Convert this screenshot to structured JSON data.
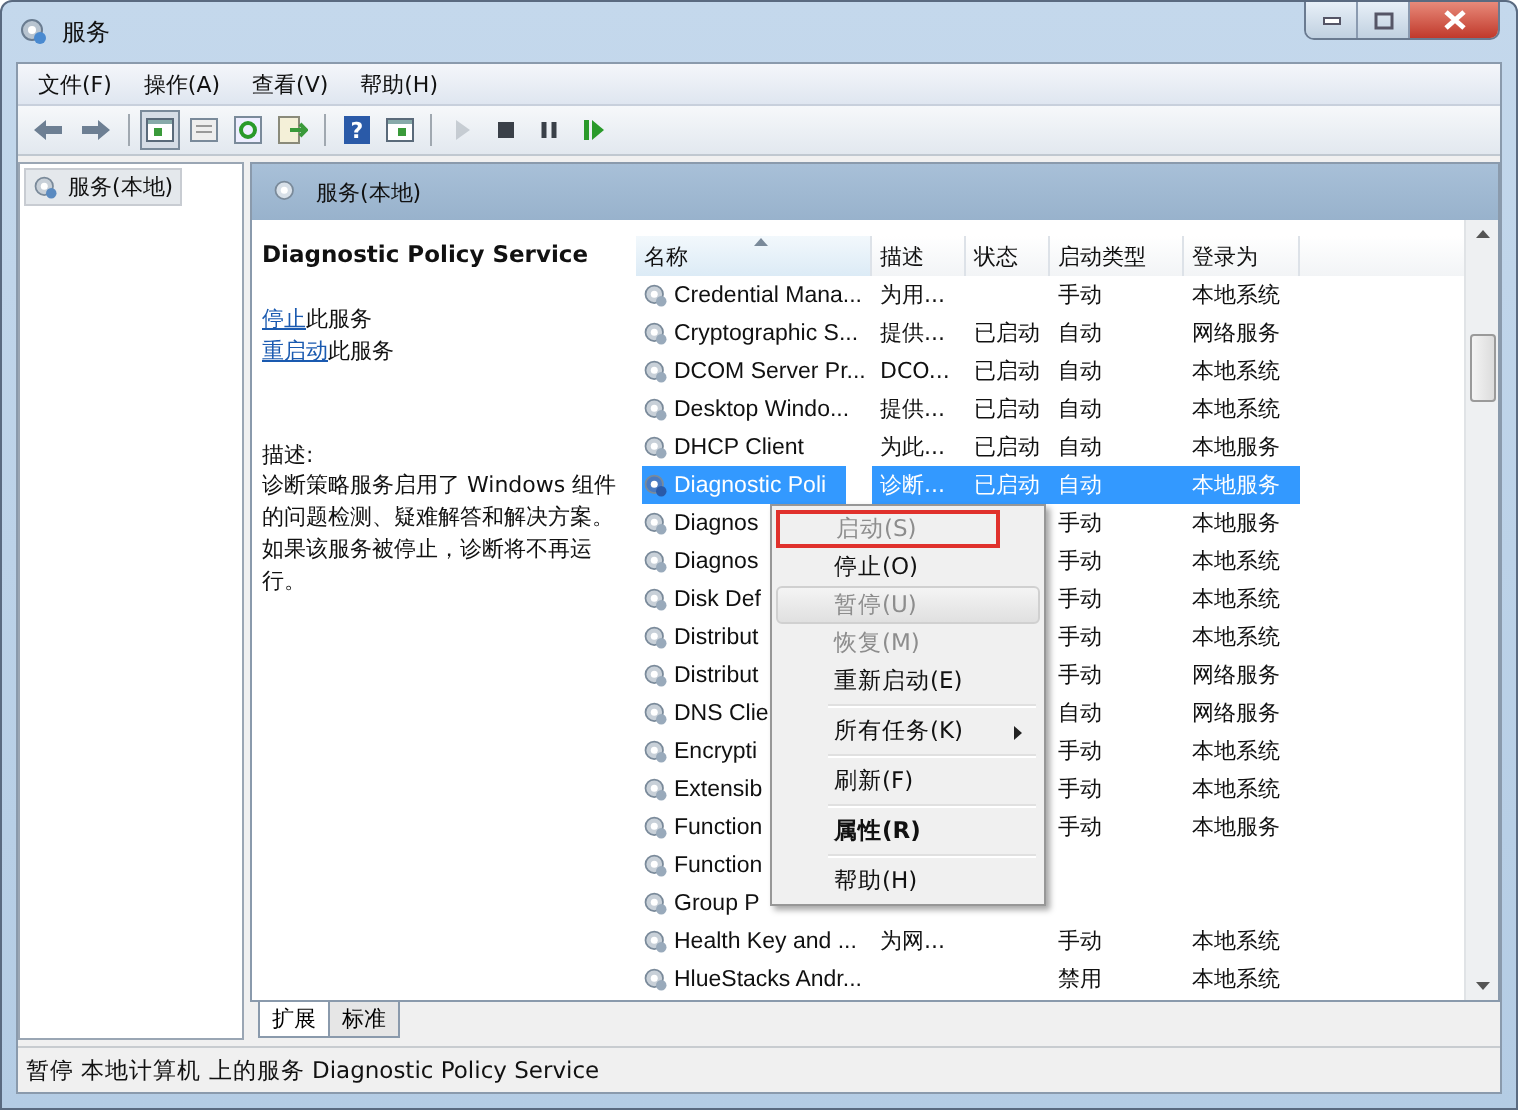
{
  "window": {
    "title": "服务"
  },
  "menu": [
    "文件(F)",
    "操作(A)",
    "查看(V)",
    "帮助(H)"
  ],
  "toolbar": [
    {
      "kind": "back",
      "pressed": false,
      "disabled": false
    },
    {
      "kind": "forward",
      "pressed": false,
      "disabled": false
    },
    {
      "kind": "sep"
    },
    {
      "kind": "tree",
      "pressed": true,
      "disabled": false
    },
    {
      "kind": "list",
      "pressed": false,
      "disabled": false
    },
    {
      "kind": "refresh",
      "pressed": false,
      "disabled": false
    },
    {
      "kind": "export",
      "pressed": false,
      "disabled": false
    },
    {
      "kind": "sep"
    },
    {
      "kind": "help",
      "pressed": false,
      "disabled": false,
      "glyph": "?"
    },
    {
      "kind": "pane",
      "pressed": false,
      "disabled": false
    },
    {
      "kind": "sep"
    },
    {
      "kind": "play",
      "pressed": false,
      "disabled": true
    },
    {
      "kind": "stop",
      "pressed": false,
      "disabled": false
    },
    {
      "kind": "pause",
      "pressed": false,
      "disabled": false
    },
    {
      "kind": "resume",
      "pressed": false,
      "disabled": false
    }
  ],
  "tree": [
    {
      "label": "服务(本地)",
      "selected": true
    }
  ],
  "panel": {
    "title": "服务(本地)"
  },
  "details": {
    "service_name": "Diagnostic Policy Service",
    "actions": [
      {
        "link": "停止",
        "text": "此服务"
      },
      {
        "link": "重启动",
        "text": "此服务"
      }
    ],
    "description_label": "描述:",
    "description": "诊断策略服务启用了 Windows 组件的问题检测、疑难解答和解决方案。如果该服务被停止，诊断将不再运行。"
  },
  "table": {
    "columns": [
      {
        "label": "名称",
        "sorted": true
      },
      {
        "label": "描述",
        "sorted": false
      },
      {
        "label": "状态",
        "sorted": false
      },
      {
        "label": "启动类型",
        "sorted": false
      },
      {
        "label": "登录为",
        "sorted": false
      }
    ],
    "rows": [
      {
        "name": "Credential Mana...",
        "desc": "为用...",
        "status": "",
        "startup": "手动",
        "logon": "本地系统",
        "selected": false
      },
      {
        "name": "Cryptographic S...",
        "desc": "提供...",
        "status": "已启动",
        "startup": "自动",
        "logon": "网络服务",
        "selected": false
      },
      {
        "name": "DCOM Server Pr...",
        "desc": "DCO...",
        "status": "已启动",
        "startup": "自动",
        "logon": "本地系统",
        "selected": false
      },
      {
        "name": "Desktop Windo...",
        "desc": "提供...",
        "status": "已启动",
        "startup": "自动",
        "logon": "本地系统",
        "selected": false
      },
      {
        "name": "DHCP Client",
        "desc": "为此...",
        "status": "已启动",
        "startup": "自动",
        "logon": "本地服务",
        "selected": false
      },
      {
        "name": "Diagnostic Poli",
        "desc": "诊断...",
        "status": "已启动",
        "startup": "自动",
        "logon": "本地服务",
        "selected": true
      },
      {
        "name": "Diagnos",
        "desc": "",
        "status": "",
        "startup": "手动",
        "logon": "本地服务",
        "selected": false
      },
      {
        "name": "Diagnos",
        "desc": "",
        "status": "",
        "startup": "手动",
        "logon": "本地系统",
        "selected": false
      },
      {
        "name": "Disk Def",
        "desc": "",
        "status": "",
        "startup": "手动",
        "logon": "本地系统",
        "selected": false
      },
      {
        "name": "Distribut",
        "desc": "",
        "status": "",
        "startup": "手动",
        "logon": "本地系统",
        "selected": false
      },
      {
        "name": "Distribut",
        "desc": "",
        "status": "",
        "startup": "手动",
        "logon": "网络服务",
        "selected": false
      },
      {
        "name": "DNS Clie",
        "desc": "",
        "status": "",
        "startup": "自动",
        "logon": "网络服务",
        "selected": false
      },
      {
        "name": "Encrypti",
        "desc": "",
        "status": "",
        "startup": "手动",
        "logon": "本地系统",
        "selected": false
      },
      {
        "name": "Extensib",
        "desc": "",
        "status": "",
        "startup": "手动",
        "logon": "本地系统",
        "selected": false
      },
      {
        "name": "Function",
        "desc": "",
        "status": "",
        "startup": "手动",
        "logon": "本地服务",
        "selected": false
      },
      {
        "name": "Function",
        "desc": "",
        "status": "",
        "startup": "",
        "logon": "",
        "selected": false
      },
      {
        "name": "Group P",
        "desc": "",
        "status": "",
        "startup": "",
        "logon": "",
        "selected": false
      },
      {
        "name": "Health Key and ...",
        "desc": "为网...",
        "status": "",
        "startup": "手动",
        "logon": "本地系统",
        "selected": false
      },
      {
        "name": "HlueStacks Andr...",
        "desc": "",
        "status": "",
        "startup": "禁用",
        "logon": "本地系统",
        "selected": false
      }
    ]
  },
  "context_menu": [
    {
      "kind": "item",
      "label": "启动(S)",
      "disabled": true,
      "hovered": false,
      "bold": false,
      "submenu": false,
      "marked": true
    },
    {
      "kind": "item",
      "label": "停止(O)",
      "disabled": false,
      "hovered": false,
      "bold": false,
      "submenu": false,
      "marked": false
    },
    {
      "kind": "item",
      "label": "暂停(U)",
      "disabled": true,
      "hovered": true,
      "bold": false,
      "submenu": false,
      "marked": false
    },
    {
      "kind": "item",
      "label": "恢复(M)",
      "disabled": true,
      "hovered": false,
      "bold": false,
      "submenu": false,
      "marked": false
    },
    {
      "kind": "item",
      "label": "重新启动(E)",
      "disabled": false,
      "hovered": false,
      "bold": false,
      "submenu": false,
      "marked": false
    },
    {
      "kind": "separator"
    },
    {
      "kind": "item",
      "label": "所有任务(K)",
      "disabled": false,
      "hovered": false,
      "bold": false,
      "submenu": true,
      "marked": false
    },
    {
      "kind": "separator"
    },
    {
      "kind": "item",
      "label": "刷新(F)",
      "disabled": false,
      "hovered": false,
      "bold": false,
      "submenu": false,
      "marked": false
    },
    {
      "kind": "separator"
    },
    {
      "kind": "item",
      "label": "属性(R)",
      "disabled": false,
      "hovered": false,
      "bold": true,
      "submenu": false,
      "marked": false
    },
    {
      "kind": "separator"
    },
    {
      "kind": "item",
      "label": "帮助(H)",
      "disabled": false,
      "hovered": false,
      "bold": false,
      "submenu": false,
      "marked": false
    }
  ],
  "tabs": [
    {
      "label": "扩展",
      "selected": true
    },
    {
      "label": "标准",
      "selected": false
    }
  ],
  "status_bar": "暂停 本地计算机 上的服务 Diagnostic Policy Service"
}
